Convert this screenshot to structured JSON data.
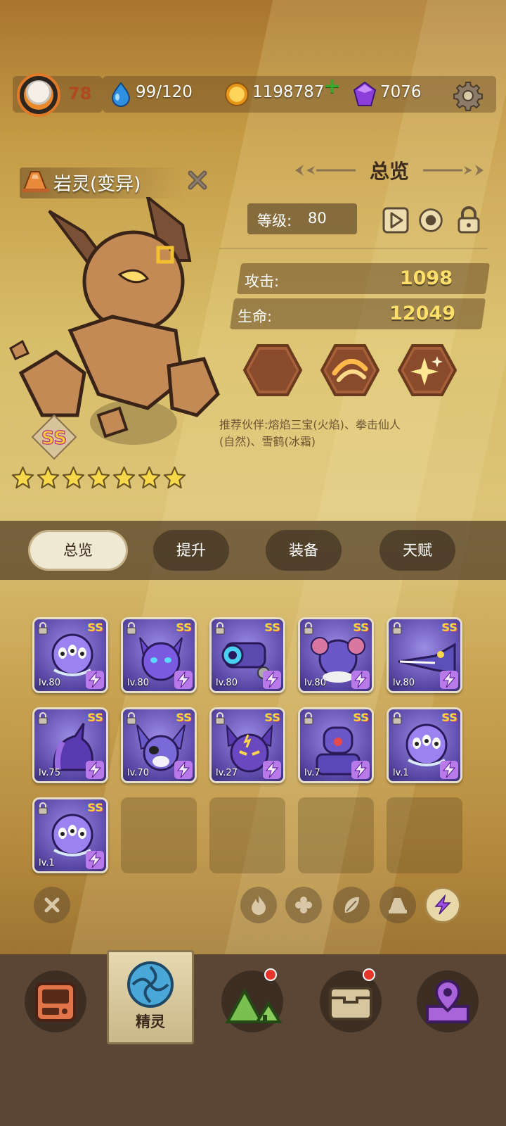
{
  "header": {
    "player_level": "78",
    "energy": "99/120",
    "coins": "1198787",
    "gems": "7076"
  },
  "character": {
    "name": "岩灵(变异)",
    "rank": "SS",
    "stars": 7
  },
  "overview": {
    "title": "总览",
    "level_label": "等级:",
    "level_value": "80",
    "attack_label": "攻击:",
    "attack_value": "1098",
    "hp_label": "生命:",
    "hp_value": "12049",
    "recommend_line1": "推荐伙伴:熔焰三宝(火焰)、拳击仙人",
    "recommend_line2": "(自然)、雪鹤(冰霜)"
  },
  "tabs": [
    {
      "label": "总览",
      "active": true
    },
    {
      "label": "提升"
    },
    {
      "label": "装备"
    },
    {
      "label": "天赋"
    }
  ],
  "pets": [
    {
      "rank": "SS",
      "level": "lv.80",
      "kind": "jellyfish"
    },
    {
      "rank": "SS",
      "level": "lv.80",
      "kind": "bat-cat"
    },
    {
      "rank": "SS",
      "level": "lv.80",
      "kind": "cannon"
    },
    {
      "rank": "SS",
      "level": "lv.80",
      "kind": "mouse"
    },
    {
      "rank": "SS",
      "level": "lv.80",
      "kind": "crocodile"
    },
    {
      "rank": "SS",
      "level": "lv.75",
      "kind": "unicorn"
    },
    {
      "rank": "SS",
      "level": "lv.70",
      "kind": "rat"
    },
    {
      "rank": "SS",
      "level": "lv.27",
      "kind": "fox"
    },
    {
      "rank": "SS",
      "level": "lv.7",
      "kind": "robot"
    },
    {
      "rank": "SS",
      "level": "lv.1",
      "kind": "jellyfish"
    },
    {
      "rank": "SS",
      "level": "lv.1",
      "kind": "jellyfish"
    }
  ],
  "filters": [
    "close",
    "fire",
    "frost",
    "nature",
    "rock",
    "lightning"
  ],
  "nav": {
    "active_label": "精灵",
    "items": [
      "shop-icon",
      "spirit-icon",
      "mountain-icon",
      "chest-icon",
      "map-pin-icon"
    ]
  },
  "colors": {
    "accent_gold": "#ffde6a",
    "lightning_purple": "#9b4fe0",
    "notification_red": "#e8352a"
  }
}
